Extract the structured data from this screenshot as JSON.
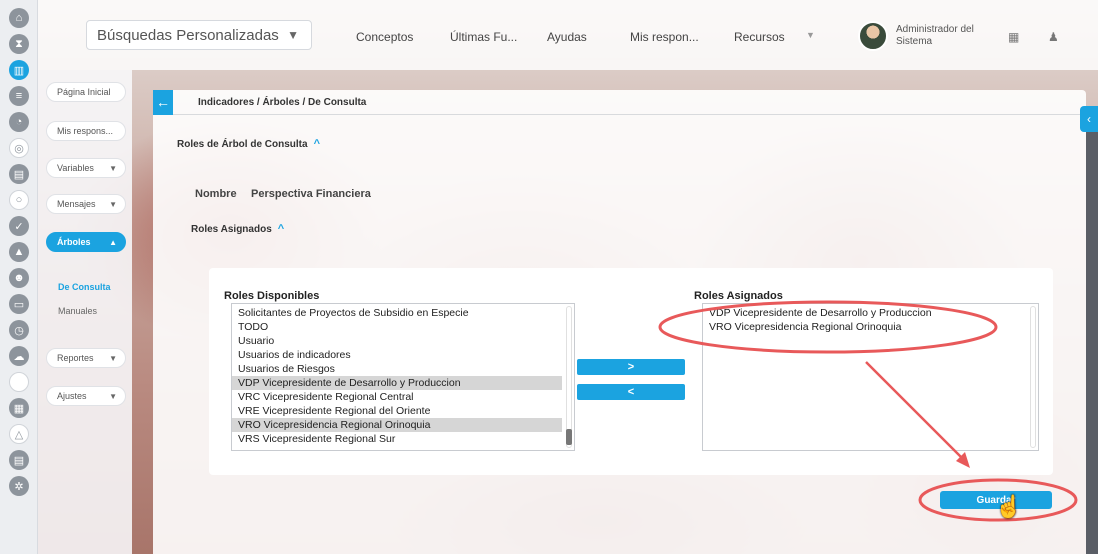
{
  "header": {
    "search_label": "Búsquedas Personalizadas",
    "nav": [
      "Conceptos",
      "Últimas Fu...",
      "Ayudas",
      "Mis respon...",
      "Recursos"
    ],
    "user_name": "Administrador del Sistema"
  },
  "side_menu": {
    "items": [
      {
        "label": "Página Inicial"
      },
      {
        "label": "Mis respons..."
      },
      {
        "label": "Variables"
      },
      {
        "label": "Mensajes"
      },
      {
        "label": "Árboles"
      },
      {
        "label": "De Consulta"
      },
      {
        "label": "Manuales"
      },
      {
        "label": "Reportes"
      },
      {
        "label": "Ajustes"
      }
    ]
  },
  "panel": {
    "breadcrumb": "Indicadores / Árboles / De Consulta",
    "section_title": "Roles de Árbol de Consulta",
    "nombre_label": "Nombre",
    "nombre_value": "Perspectiva Financiera",
    "roles_asignados_title": "Roles Asignados",
    "available_title": "Roles Disponibles",
    "assigned_title": "Roles Asignados",
    "available_items": [
      "Solicitantes de Proyectos de Subsidio en Especie",
      "TODO",
      "Usuario",
      "Usuarios de indicadores",
      "Usuarios de Riesgos",
      "VDP Vicepresidente de Desarrollo y Produccion",
      "VRC Vicepresidente Regional Central",
      "VRE Vicepresidente Regional del Oriente",
      "VRO Vicepresidencia Regional Orinoquia",
      "VRS Vicepresidente Regional Sur"
    ],
    "available_selected": [
      5,
      8
    ],
    "assigned_items": [
      "VDP Vicepresidente de Desarrollo y Produccion",
      "VRO Vicepresidencia Regional Orinoquia"
    ],
    "add_label": ">",
    "remove_label": "<",
    "save_label": "Guardar"
  },
  "colors": {
    "accent": "#1ba3e0",
    "annotation": "#e8595a"
  },
  "icons": {
    "rail": [
      "home-icon",
      "hourglass-icon",
      "chart-icon",
      "list-icon",
      "gauge-icon",
      "target-icon",
      "stack-icon",
      "circle-icon",
      "check-icon",
      "warning-icon",
      "group-icon",
      "monitor-icon",
      "clock-icon",
      "cloud-icon",
      "blank-icon",
      "calendar-icon",
      "network-icon",
      "document-icon",
      "settings-icon"
    ]
  }
}
